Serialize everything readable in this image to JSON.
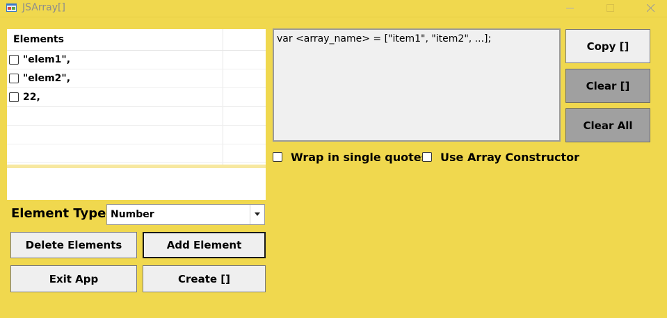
{
  "window": {
    "title": "JSArray[]",
    "icon": "app-icon",
    "controls": [
      "minimize-icon",
      "maximize-icon",
      "close-icon"
    ]
  },
  "elements_list": {
    "header": "Elements",
    "items": [
      {
        "label": "\"elem1\",",
        "checked": false
      },
      {
        "label": "\"elem2\",",
        "checked": false
      },
      {
        "label": "22,",
        "checked": false
      }
    ]
  },
  "new_element_input": {
    "value": ""
  },
  "element_type": {
    "label": "Element Type",
    "selected": "Number"
  },
  "buttons": {
    "delete": "Delete Elements",
    "add": "Add Element",
    "exit": "Exit App",
    "create": "Create []",
    "copy": "Copy []",
    "clear": "Clear []",
    "clear_all": "Clear All"
  },
  "output": {
    "text": "var <array_name> = [\"item1\", \"item2\", ...];"
  },
  "options": {
    "wrap_single_quotes": {
      "label": "Wrap in single quotes",
      "checked": false
    },
    "use_array_constructor": {
      "label": "Use Array Constructor",
      "checked": false
    }
  },
  "colors": {
    "background": "#F0D84E",
    "button": "#EFEFEF",
    "button_dark": "#A0A0A0"
  }
}
